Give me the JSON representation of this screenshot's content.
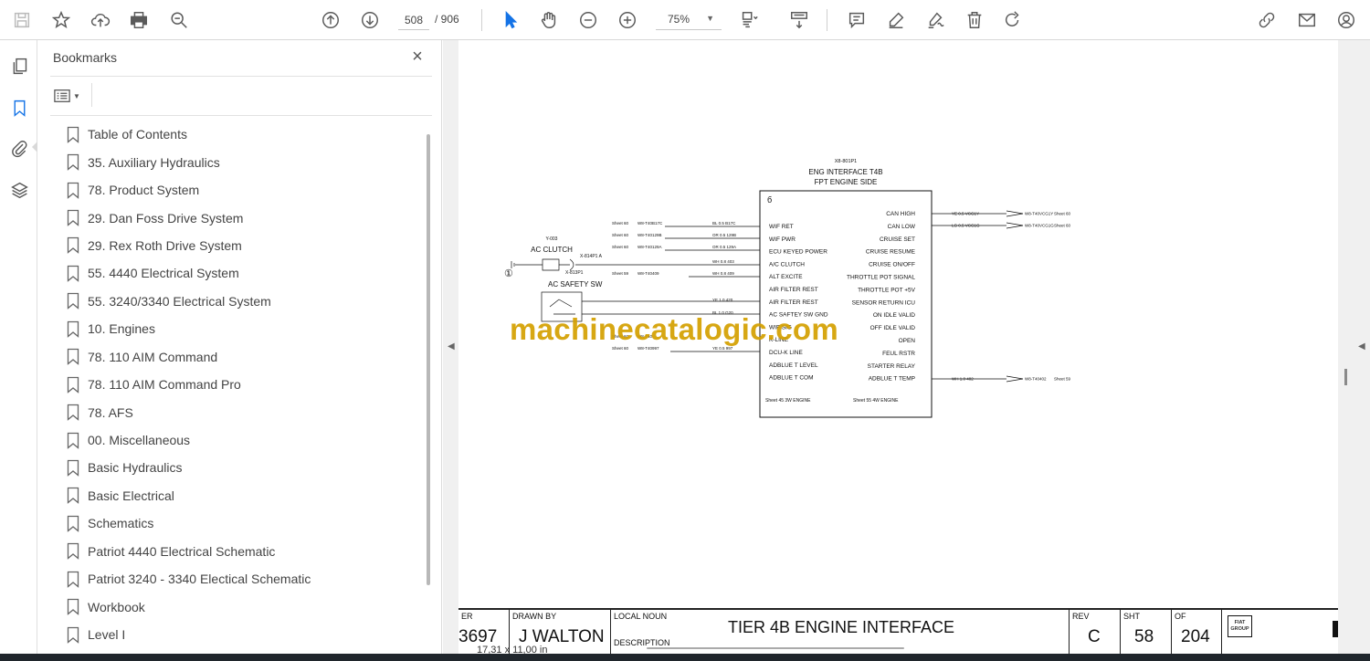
{
  "toolbar": {
    "page_current": "508",
    "page_total": "/ 906",
    "zoom": "75%"
  },
  "bookmarks_panel": {
    "title": "Bookmarks",
    "close_glyph": "×",
    "items": [
      {
        "label": "Table of Contents"
      },
      {
        "label": "35. Auxiliary Hydraulics"
      },
      {
        "label": "78. Product System"
      },
      {
        "label": "29. Dan Foss Drive System"
      },
      {
        "label": "29. Rex Roth Drive System"
      },
      {
        "label": "55. 4440 Electrical System"
      },
      {
        "label": "55. 3240/3340 Electrical System"
      },
      {
        "label": "10. Engines"
      },
      {
        "label": "78. 110 AIM Command"
      },
      {
        "label": "78. 110 AIM Command Pro"
      },
      {
        "label": "78. AFS"
      },
      {
        "label": "00. Miscellaneous"
      },
      {
        "label": "Basic Hydraulics"
      },
      {
        "label": "Basic Electrical"
      },
      {
        "label": "Schematics"
      },
      {
        "label": "Patriot 4440 Electrical Schematic"
      },
      {
        "label": "Patriot 3240 - 3340 Electical Schematic"
      },
      {
        "label": "Workbook"
      },
      {
        "label": "Level I"
      }
    ]
  },
  "schematic": {
    "connector_id": "X8-801P1",
    "title_line1": "ENG INTERFACE T4B",
    "title_line2": "FPT ENGINE SIDE",
    "left_pins": [
      "WIF RET",
      "WIF PWR",
      "ECU KEYED POWER",
      "A/C CLUTCH",
      "ALT EXCITE",
      "AIR FILTER REST",
      "AIR FILTER REST",
      "AC SAFTEY SW GND",
      "WIF SIG",
      "K-LINE",
      "DCU-K LINE",
      "ADBLUE T LEVEL",
      "ADBLUE T COM"
    ],
    "right_pins": [
      "CAN HIGH",
      "CAN LOW",
      "CRUISE SET",
      "CRUISE RESUME",
      "CRUISE ON/OFF",
      "THROTTLE POT SIGNAL",
      "THROTTLE POT +5V",
      "SENSOR RETURN ICU",
      "ON IDLE VALID",
      "OFF IDLE VALID",
      "OPEN",
      "FEUL RSTR",
      "STARTER RELAY",
      "ADBLUE T TEMP"
    ],
    "left_wires": [
      {
        "sheet": "Sheet 60",
        "ref": "W8-T40B17C",
        "wire": "BL 0.5 B17C"
      },
      {
        "sheet": "Sheet 60",
        "ref": "W8-T40129B",
        "wire": "OR 0.5 129B"
      },
      {
        "sheet": "Sheet 60",
        "ref": "W8-T40129A",
        "wire": "OR 0.5 129A"
      },
      {
        "sheet": "",
        "ref": "",
        "wire": "WH 0.8 403"
      },
      {
        "sheet": "Sheet 59",
        "ref": "W8-T40409",
        "wire": "WH 0.8 409"
      },
      {
        "sheet": "",
        "ref": "",
        "wire": "YE 1.0 420"
      },
      {
        "sheet": "",
        "ref": "",
        "wire": "BL 1.0 G20"
      },
      {
        "sheet": "Sheet 60",
        "ref": "W8-T40",
        "wire": ""
      },
      {
        "sheet": "Sheet 60",
        "ref": "W8-T40997",
        "wire": "YE 0.5 997"
      }
    ],
    "right_wires": [
      {
        "wire": "YE 0.5 VCG1Y",
        "ref": "W8-T40VCG1Y",
        "sheet": "Sheet 60"
      },
      {
        "wire": "LG 0.5 VCG1G",
        "ref": "W8-T40VCG1G",
        "sheet": "Sheet 60"
      },
      {
        "wire": "WH 1.0 402",
        "ref": "W8-T40402",
        "sheet": "Sheet 59"
      }
    ],
    "bottom_left_note": "Sheet 45    3W ENGINE",
    "bottom_right_note": "Sheet 55    4W ENGINE",
    "ac_clutch_id": "Y-003",
    "ac_clutch_label": "AC CLUTCH",
    "ac_clutch_conn": "X-814P1 A",
    "ac_safety_id": "X-813P1",
    "ac_safety_label": "AC SAFETY SW",
    "ground_marker": "①"
  },
  "watermark": "machinecatalogic.com",
  "title_block": {
    "er_label": "ER",
    "er_value": "3697",
    "drawn_by_label": "DRAWN BY",
    "drawn_by_value": "J WALTON",
    "local_noun_label": "LOCAL NOUN",
    "local_noun_value": "TIER 4B ENGINE INTERFACE",
    "description_label": "DESCRIPTION",
    "rev_label": "REV",
    "rev_value": "C",
    "sht_label": "SHT",
    "sht_value": "58",
    "of_label": "OF",
    "of_value": "204",
    "logo_text": "FIAT GROUP"
  },
  "page_size": "17,31 x 11,00 in"
}
